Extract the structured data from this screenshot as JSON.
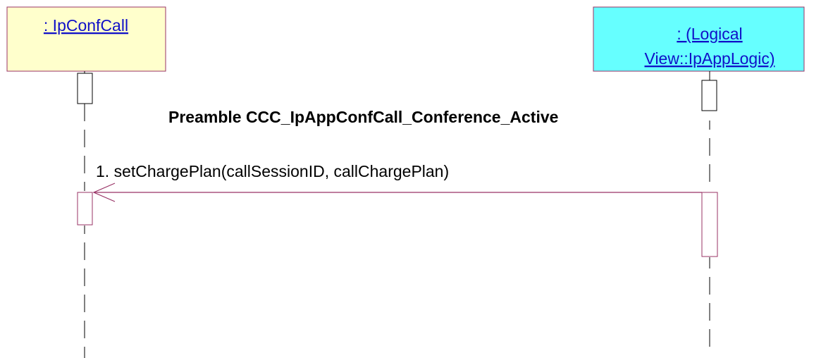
{
  "participants": [
    {
      "id": "ipconfcall",
      "label_lines": [
        ": IpConfCall"
      ],
      "fill": "#ffffcc",
      "border": "#993366"
    },
    {
      "id": "ipapplogic",
      "label_lines": [
        ": (Logical",
        "View::IpAppLogic)"
      ],
      "fill": "#66ffff",
      "border": "#993366"
    }
  ],
  "preamble": "Preamble CCC_IpAppConfCall_Conference_Active",
  "messages": [
    {
      "label": "1. setChargePlan(callSessionID, callChargePlan)",
      "from": "ipapplogic",
      "to": "ipconfcall"
    }
  ],
  "colors": {
    "label_text": "#1010c8",
    "message_arrow": "#993366",
    "lifeline": "#000000",
    "activation_border": "#993366",
    "activation_border_preamble": "#000000"
  }
}
